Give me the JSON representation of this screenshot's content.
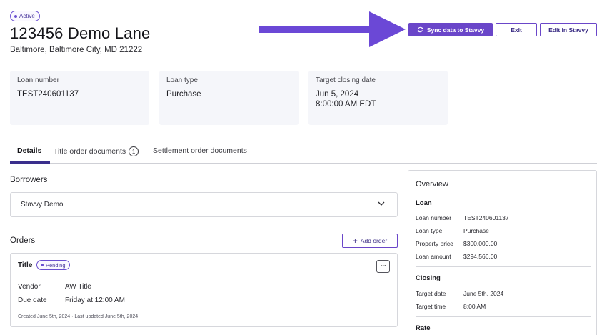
{
  "header": {
    "status": "Active",
    "title": "123456 Demo Lane",
    "address": "Baltimore, Baltimore City, MD 21222"
  },
  "actions": {
    "sync_label": "Sync data to Stavvy",
    "exit_label": "Exit",
    "edit_label": "Edit in Stavvy"
  },
  "summary_cards": [
    {
      "label": "Loan number",
      "value": "TEST240601137"
    },
    {
      "label": "Loan type",
      "value": "Purchase"
    },
    {
      "label": "Target closing date",
      "value": "Jun 5, 2024",
      "value2": "8:00:00 AM EDT"
    }
  ],
  "tabs": {
    "details": "Details",
    "title_docs": "Title order documents",
    "title_docs_count": "1",
    "settlement_docs": "Settlement order documents"
  },
  "borrowers": {
    "heading": "Borrowers",
    "name": "Stavvy Demo"
  },
  "orders": {
    "heading": "Orders",
    "add_label": "Add order",
    "items": [
      {
        "title": "Title",
        "status": "Pending",
        "vendor_key": "Vendor",
        "vendor": "AW Title",
        "due_key": "Due date",
        "due": "Friday at 12:00 AM",
        "meta": "Created June 5th, 2024 · Last updated June 5th, 2024"
      }
    ]
  },
  "overview": {
    "title": "Overview",
    "loan_heading": "Loan",
    "loan_rows": [
      {
        "k": "Loan number",
        "v": "TEST240601137"
      },
      {
        "k": "Loan type",
        "v": "Purchase"
      },
      {
        "k": "Property price",
        "v": "$300,000.00"
      },
      {
        "k": "Loan amount",
        "v": "$294,566.00"
      }
    ],
    "closing_heading": "Closing",
    "closing_rows": [
      {
        "k": "Target date",
        "v": "June 5th, 2024"
      },
      {
        "k": "Target time",
        "v": "8:00 AM"
      }
    ],
    "rate_heading": "Rate"
  },
  "colors": {
    "primary": "#6a46c9",
    "arrow": "#6b48d6",
    "card_bg": "#f5f6fa"
  }
}
